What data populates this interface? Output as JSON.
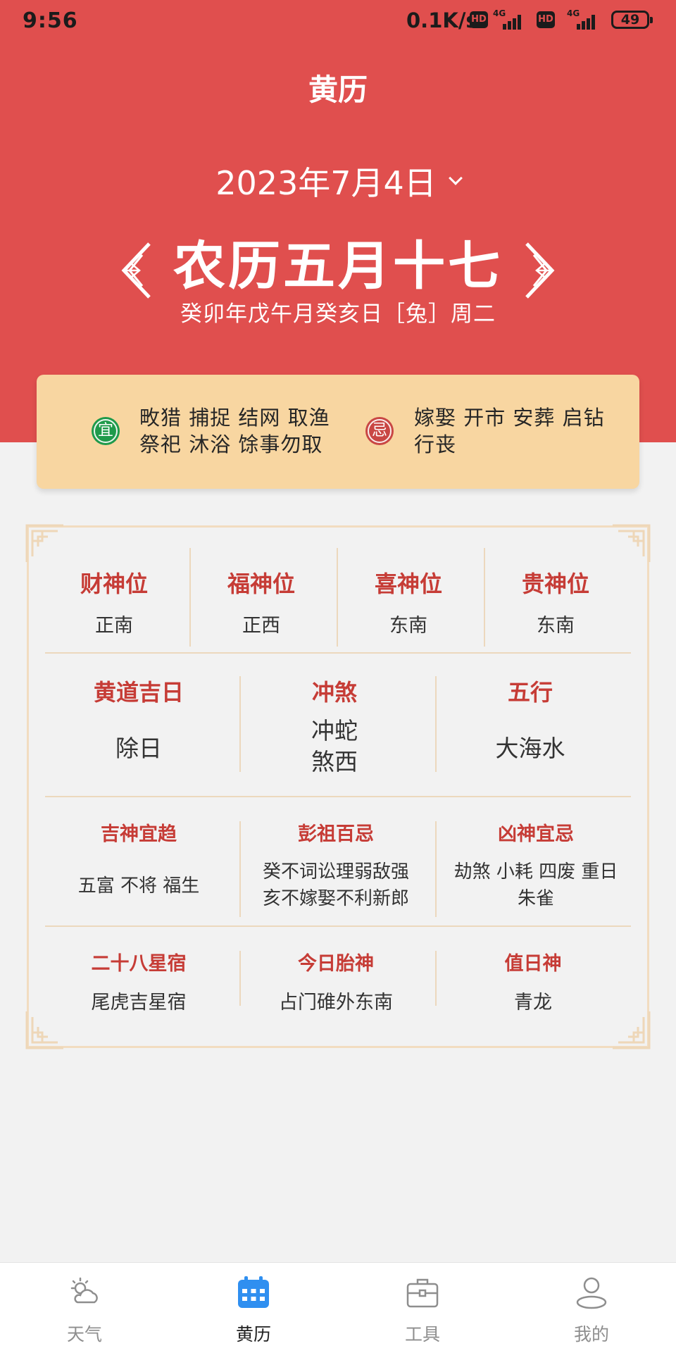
{
  "status_bar": {
    "time": "9:56",
    "network_speed": "0.1K/s",
    "hd_label": "HD",
    "network_type": "4G",
    "battery": "49"
  },
  "header": {
    "title": "黄历"
  },
  "date_selector": {
    "date": "2023年7月4日"
  },
  "lunar": {
    "date": "农历五月十七",
    "ganzhi": "癸卯年戊午月癸亥日［兔］周二"
  },
  "yiji": {
    "yi_icon": "宜",
    "yi_line1": "畋猎 捕捉 结网 取渔",
    "yi_line2": "祭祀 沐浴 馀事勿取",
    "ji_icon": "忌",
    "ji_line1": "嫁娶 开市 安葬 启钻",
    "ji_line2": "行丧"
  },
  "deities": [
    {
      "title": "财神位",
      "value": "正南"
    },
    {
      "title": "福神位",
      "value": "正西"
    },
    {
      "title": "喜神位",
      "value": "东南"
    },
    {
      "title": "贵神位",
      "value": "东南"
    }
  ],
  "row2": [
    {
      "title": "黄道吉日",
      "value": "除日"
    },
    {
      "title": "冲煞",
      "value_line1": "冲蛇",
      "value_line2": "煞西"
    },
    {
      "title": "五行",
      "value": "大海水"
    }
  ],
  "row3": [
    {
      "title": "吉神宜趋",
      "value": "五富 不将 福生"
    },
    {
      "title": "彭祖百忌",
      "value_line1": "癸不词讼理弱敌强",
      "value_line2": "亥不嫁娶不利新郎"
    },
    {
      "title": "凶神宜忌",
      "value_line1": "劫煞 小耗 四废 重日",
      "value_line2": "朱雀"
    }
  ],
  "row4": [
    {
      "title": "二十八星宿",
      "value": "尾虎吉星宿"
    },
    {
      "title": "今日胎神",
      "value": "占门碓外东南"
    },
    {
      "title": "值日神",
      "value": "青龙"
    }
  ],
  "bottom_nav": [
    {
      "label": "天气",
      "icon": "weather-icon",
      "active": false
    },
    {
      "label": "黄历",
      "icon": "calendar-icon",
      "active": true
    },
    {
      "label": "工具",
      "icon": "toolbox-icon",
      "active": false
    },
    {
      "label": "我的",
      "icon": "profile-icon",
      "active": false
    }
  ],
  "colors": {
    "brand_red": "#e04f4e",
    "yiji_bg": "#f8d6a1",
    "yi_green": "#1f9a4b",
    "ji_red": "#c94744",
    "heading_red": "#c63c36",
    "nav_active_blue": "#2f8ff0"
  }
}
